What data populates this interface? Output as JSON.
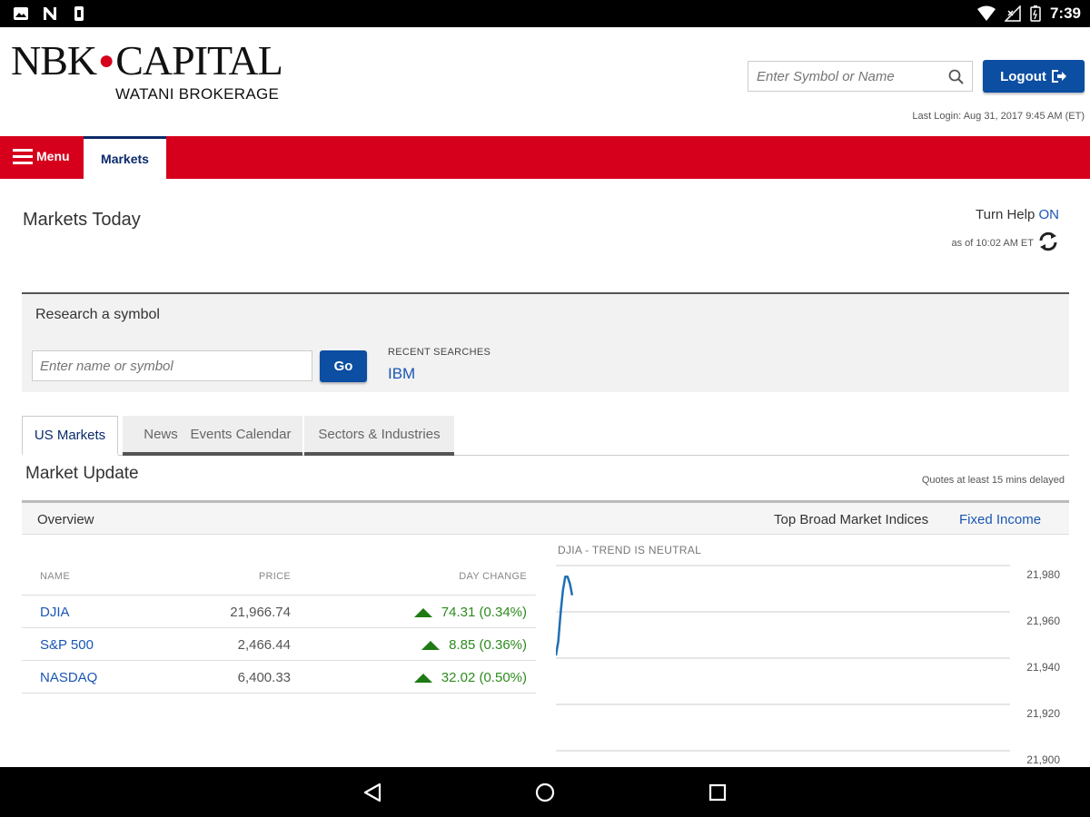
{
  "status_bar": {
    "time": "7:39",
    "left_icons": [
      "image-icon",
      "n-notification-icon",
      "battery-saver-icon"
    ],
    "right_icons": [
      "wifi-icon",
      "no-signal-icon",
      "battery-icon"
    ]
  },
  "header": {
    "logo_main": "NBK",
    "logo_main_2": "CAPITAL",
    "logo_sub": "WATANI BROKERAGE",
    "search_placeholder": "Enter Symbol or Name",
    "logout_label": "Logout",
    "last_login": "Last Login: Aug 31, 2017 9:45 AM (ET)"
  },
  "nav": {
    "menu_label": "Menu",
    "active_tab": "Markets"
  },
  "page": {
    "title": "Markets Today",
    "help_label": "Turn Help",
    "help_state": "ON",
    "as_of": "as of 10:02 AM ET"
  },
  "research": {
    "title": "Research a symbol",
    "input_placeholder": "Enter name or symbol",
    "go_label": "Go",
    "recent_label": "RECENT SEARCHES",
    "recent_items": [
      "IBM"
    ]
  },
  "tabs": [
    {
      "label": "US Markets",
      "active": true
    },
    {
      "label": "News",
      "active": false
    },
    {
      "label": "Events Calendar",
      "active": false
    },
    {
      "label": "Sectors & Industries",
      "active": false
    }
  ],
  "market_update": {
    "title": "Market Update",
    "delay_note": "Quotes at least 15 mins delayed",
    "overview_label": "Overview",
    "top_indices_label": "Top Broad Market Indices",
    "fixed_income_label": "Fixed Income"
  },
  "indices_table": {
    "columns": [
      "NAME",
      "PRICE",
      "DAY CHANGE"
    ],
    "rows": [
      {
        "name": "DJIA",
        "price": "21,966.74",
        "change": "74.31 (0.34%)",
        "direction": "up"
      },
      {
        "name": "S&P 500",
        "price": "2,466.44",
        "change": "8.85 (0.36%)",
        "direction": "up"
      },
      {
        "name": "NASDAQ",
        "price": "6,400.33",
        "change": "32.02 (0.50%)",
        "direction": "up"
      }
    ]
  },
  "colors": {
    "brand_red": "#d6001c",
    "brand_blue": "#0c4ea2",
    "link_blue": "#1a56b4",
    "up_green": "#2e8b1e"
  },
  "chart_data": {
    "type": "line",
    "title": "DJIA - TREND IS NEUTRAL",
    "ylim": [
      21900,
      21980
    ],
    "y_ticks": [
      "21,980",
      "21,960",
      "21,940",
      "21,920",
      "21,900"
    ],
    "y_tick_values": [
      21980,
      21960,
      21940,
      21920,
      21900
    ],
    "grid": true,
    "series": [
      {
        "color": "#1f6fb3",
        "points": [
          [
            0,
            21940
          ],
          [
            2,
            21946
          ],
          [
            4,
            21958
          ],
          [
            6,
            21968
          ],
          [
            8,
            21974
          ],
          [
            10,
            21974
          ],
          [
            12,
            21971
          ],
          [
            14,
            21966
          ]
        ]
      }
    ],
    "x_max": 390
  }
}
